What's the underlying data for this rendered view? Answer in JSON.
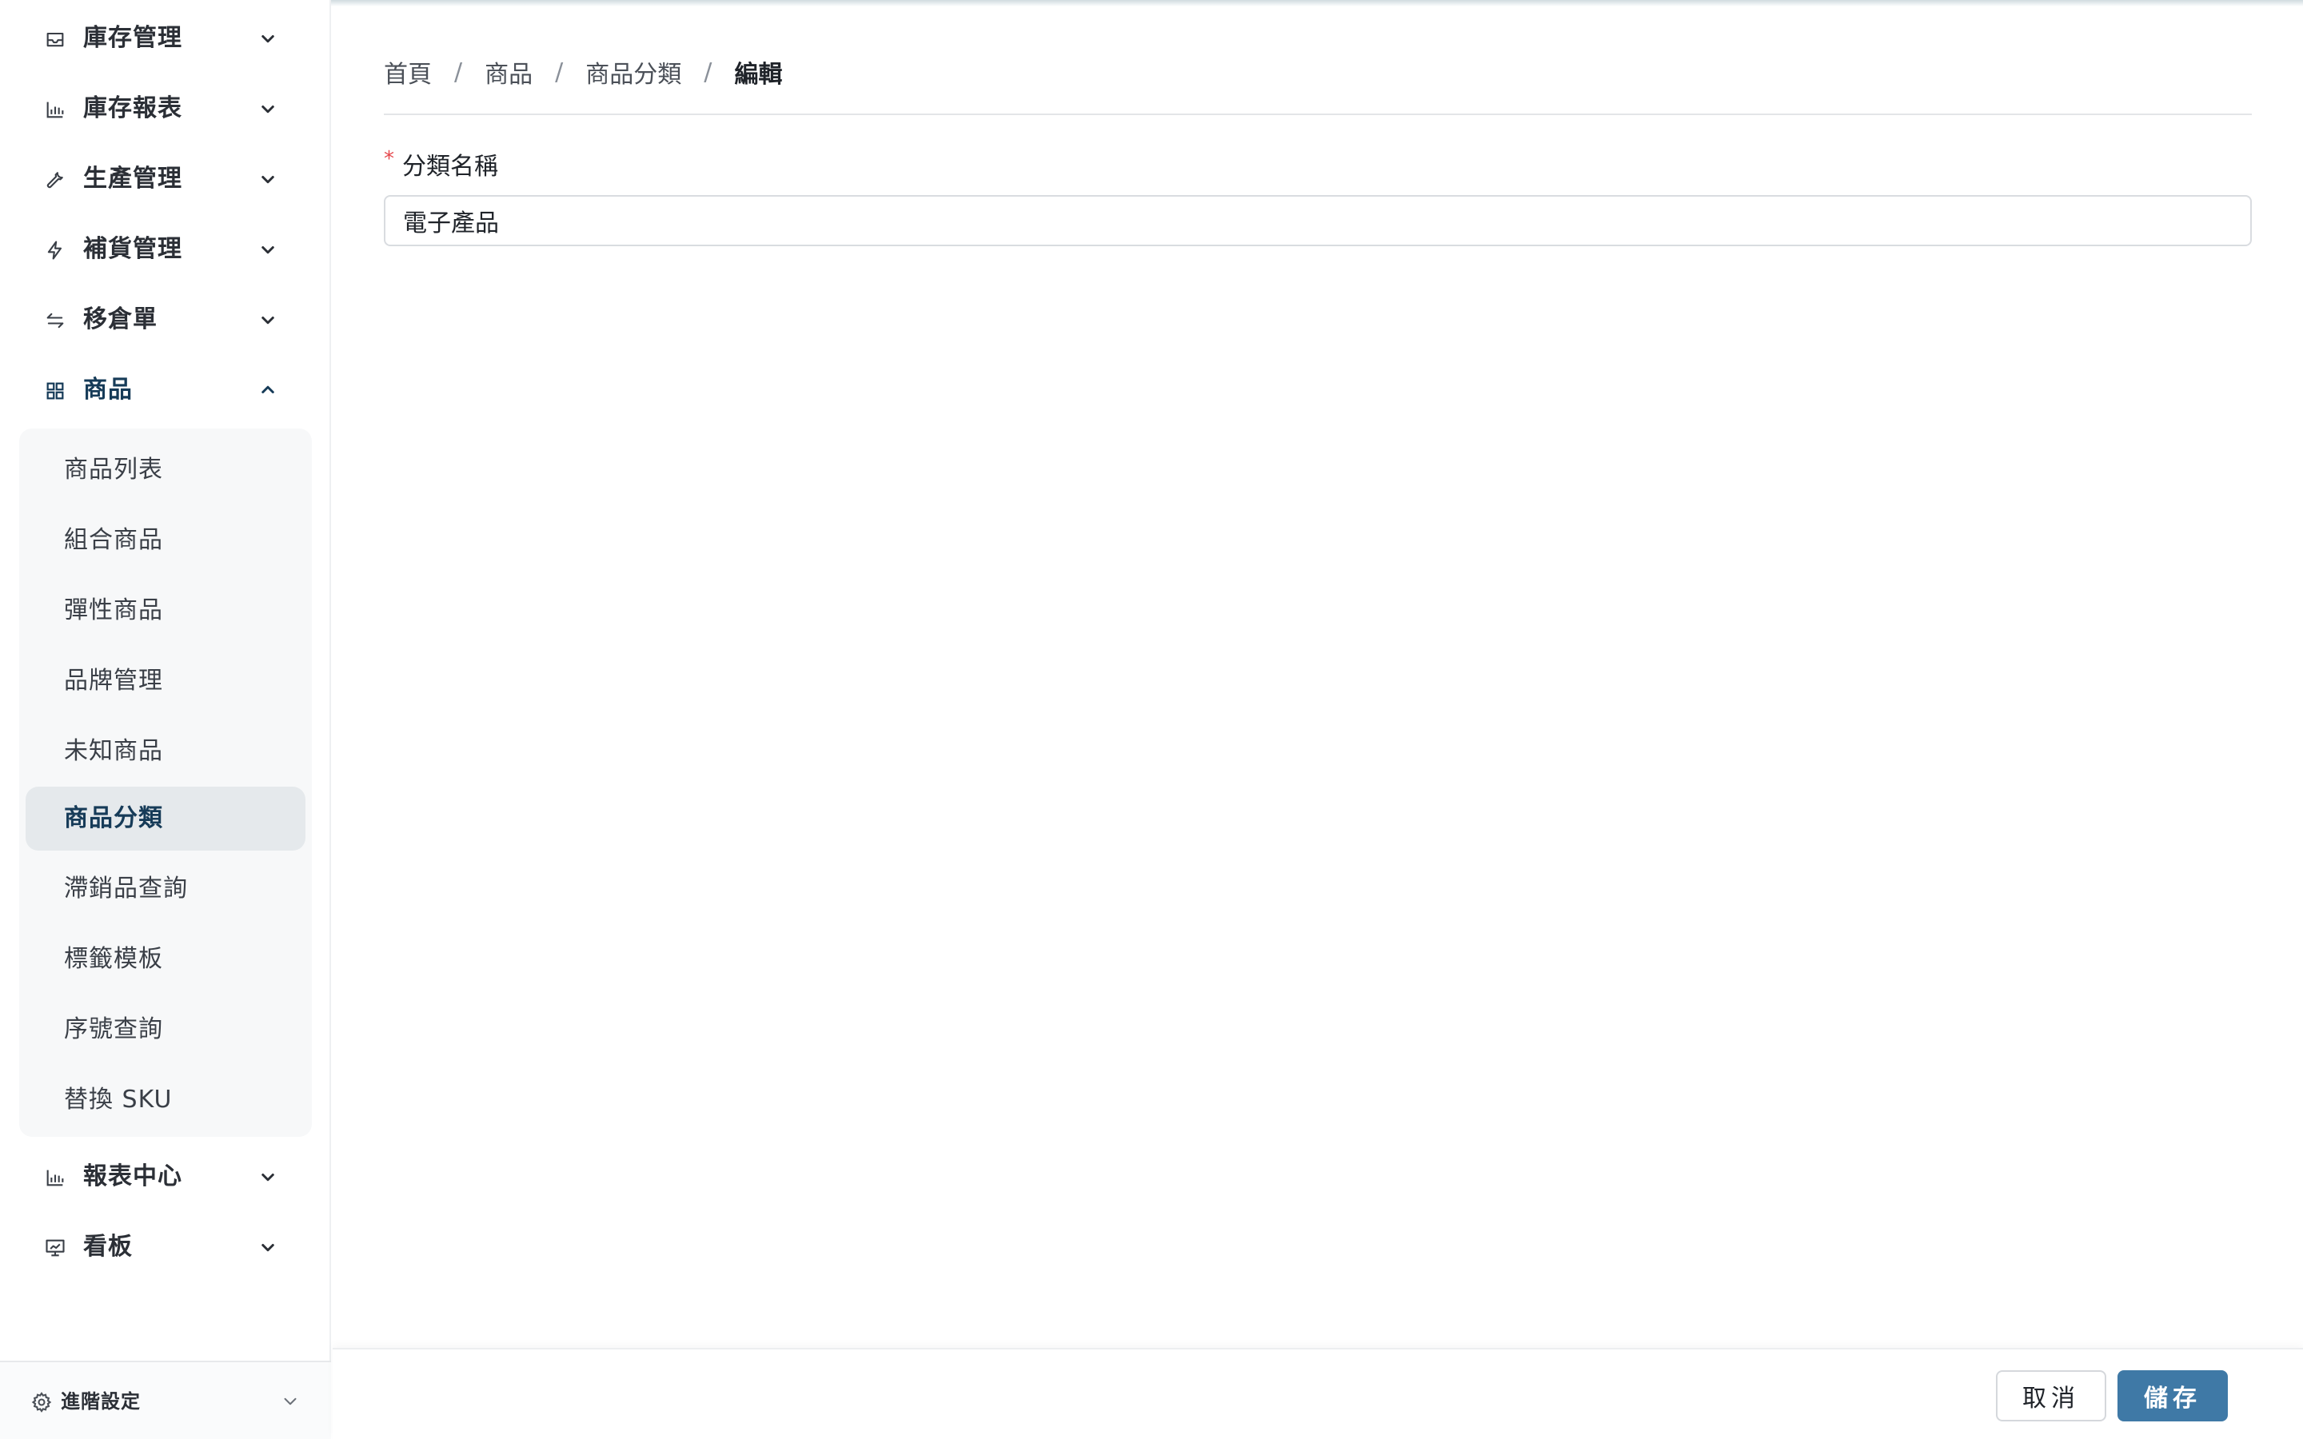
{
  "sidebar": {
    "menu": [
      {
        "label": "庫存管理",
        "icon": "inbox-icon",
        "expanded": false
      },
      {
        "label": "庫存報表",
        "icon": "bar-chart-icon",
        "expanded": false
      },
      {
        "label": "生產管理",
        "icon": "wrench-icon",
        "expanded": false
      },
      {
        "label": "補貨管理",
        "icon": "lightning-icon",
        "expanded": false
      },
      {
        "label": "移倉單",
        "icon": "transfer-arrows-icon",
        "expanded": false
      },
      {
        "label": "商品",
        "icon": "grid-icon",
        "expanded": true
      },
      {
        "label": "報表中心",
        "icon": "bar-chart-icon",
        "expanded": false
      },
      {
        "label": "看板",
        "icon": "presentation-chart-icon",
        "expanded": false
      }
    ],
    "product_submenu": [
      {
        "label": "商品列表"
      },
      {
        "label": "組合商品"
      },
      {
        "label": "彈性商品"
      },
      {
        "label": "品牌管理"
      },
      {
        "label": "未知商品"
      },
      {
        "label": "商品分類",
        "active": true
      },
      {
        "label": "滯銷品查詢"
      },
      {
        "label": "標籤模板"
      },
      {
        "label": "序號查詢"
      },
      {
        "label": "替換 SKU"
      }
    ],
    "footer": {
      "label": "進階設定",
      "icon": "gear-icon"
    }
  },
  "breadcrumb": [
    "首頁",
    "商品",
    "商品分類",
    "編輯"
  ],
  "form": {
    "category_name": {
      "label": "分類名稱",
      "required_mark": "*",
      "value": "電子產品"
    }
  },
  "actions": {
    "cancel_label": "取消",
    "save_label": "儲存"
  },
  "colors": {
    "primary": "#3f79a6",
    "active_text": "#163b58",
    "active_bg": "#e5e9ec",
    "required": "#e5484d"
  }
}
